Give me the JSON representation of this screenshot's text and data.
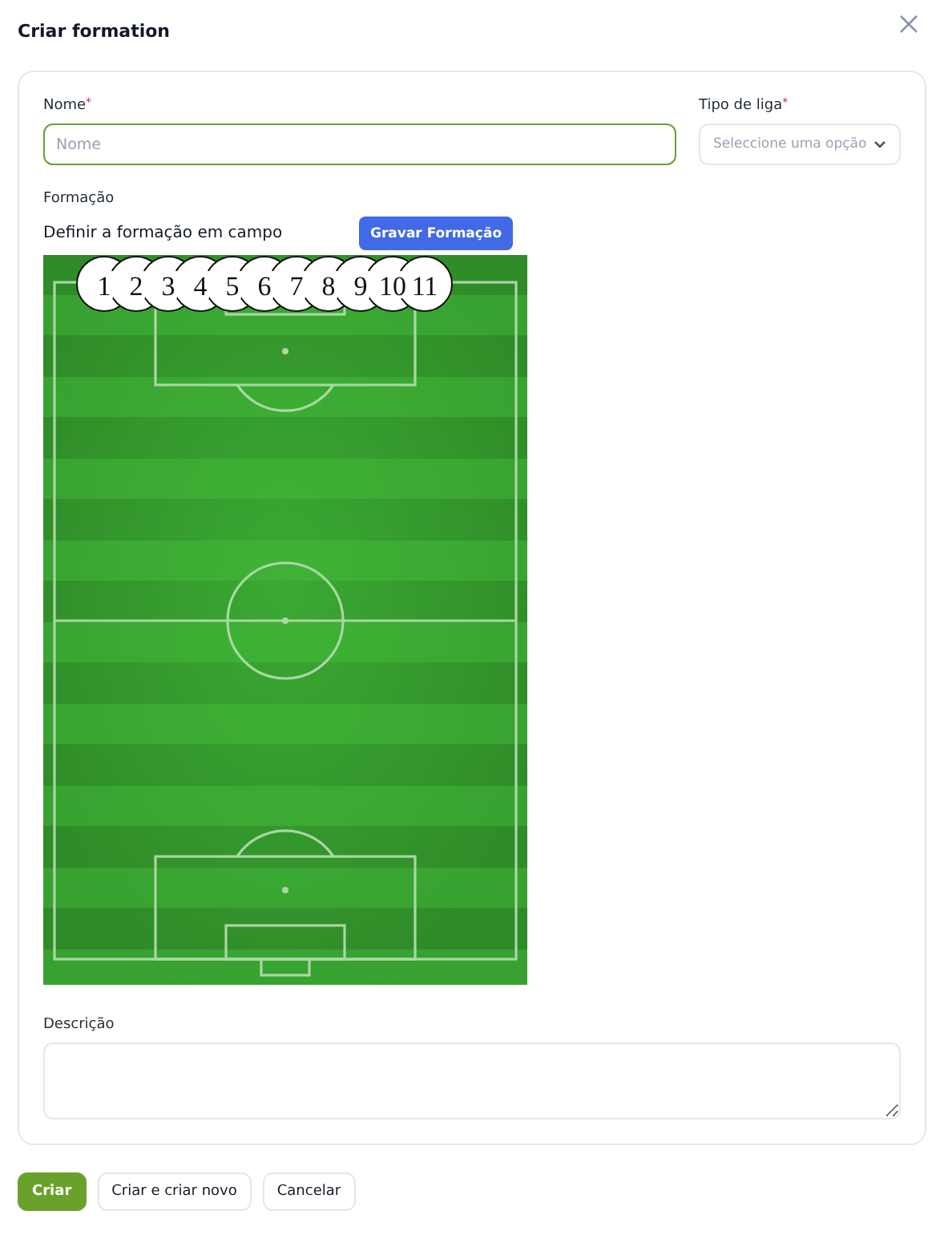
{
  "modal": {
    "title": "Criar formation"
  },
  "fields": {
    "name": {
      "label": "Nome",
      "required_mark": "*",
      "placeholder": "Nome"
    },
    "league_type": {
      "label": "Tipo de liga",
      "required_mark": "*",
      "placeholder": "Seleccione uma opção"
    }
  },
  "formation": {
    "label": "Formação",
    "hint": "Definir a formação em campo",
    "save_button": "Gravar Formação",
    "players": [
      "1",
      "2",
      "3",
      "4",
      "5",
      "6",
      "7",
      "8",
      "9",
      "10",
      "11"
    ]
  },
  "description": {
    "label": "Descrição"
  },
  "buttons": [
    {
      "label": "Criar",
      "kind": "primary"
    },
    {
      "label": "Criar e criar novo",
      "kind": "secondary"
    },
    {
      "label": "Cancelar",
      "kind": "secondary"
    }
  ]
}
